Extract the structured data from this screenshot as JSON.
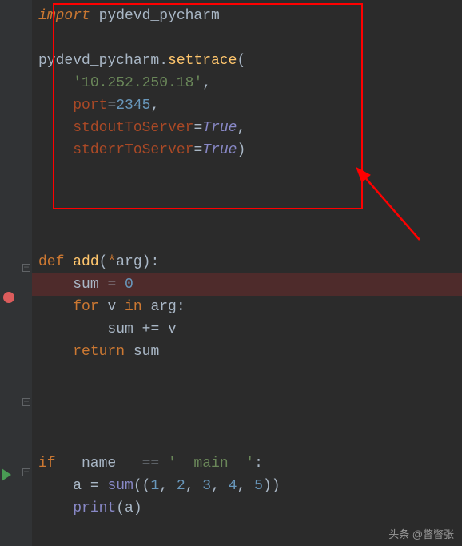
{
  "code": {
    "l1_import": "import",
    "l1_module": " pydevd_pycharm",
    "l3_obj": "pydevd_pycharm",
    "l3_dot": ".",
    "l3_call": "settrace",
    "l3_open": "(",
    "l4_ip": "'10.252.250.18'",
    "l4_comma": ",",
    "l5_port_kw": "port",
    "l5_eq": "=",
    "l5_port_val": "2345",
    "l5_comma": ",",
    "l6_stdout_kw": "stdoutToServer",
    "l6_eq": "=",
    "l6_true": "True",
    "l6_comma": ",",
    "l7_stderr_kw": "stderrToServer",
    "l7_eq": "=",
    "l7_true": "True",
    "l7_close": ")",
    "l10_def": "def ",
    "l10_fn": "add",
    "l10_open": "(",
    "l10_star": "*",
    "l10_arg": "arg",
    "l10_close": ")",
    "l10_colon": ":",
    "l11_sum": "sum ",
    "l11_eq": "= ",
    "l11_zero": "0",
    "l12_for": "for ",
    "l12_v": "v ",
    "l12_in": "in ",
    "l12_arg": "arg",
    "l12_colon": ":",
    "l13_sum": "sum ",
    "l13_pluseq": "+= ",
    "l13_v": "v",
    "l14_return": "return ",
    "l14_sum": "sum",
    "l17_if": "if ",
    "l17_name": "__name__ ",
    "l17_eqeq": "== ",
    "l17_main": "'__main__'",
    "l17_colon": ":",
    "l18_a": "a ",
    "l18_eq": "= ",
    "l18_sum": "sum",
    "l18_open": "((",
    "l18_n1": "1",
    "l18_c1": ", ",
    "l18_n2": "2",
    "l18_c2": ", ",
    "l18_n3": "3",
    "l18_c3": ", ",
    "l18_n4": "4",
    "l18_c4": ", ",
    "l18_n5": "5",
    "l18_close": "))",
    "l19_print": "print",
    "l19_open": "(",
    "l19_a": "a",
    "l19_close": ")"
  },
  "watermark": "头条 @瞥瞥张"
}
